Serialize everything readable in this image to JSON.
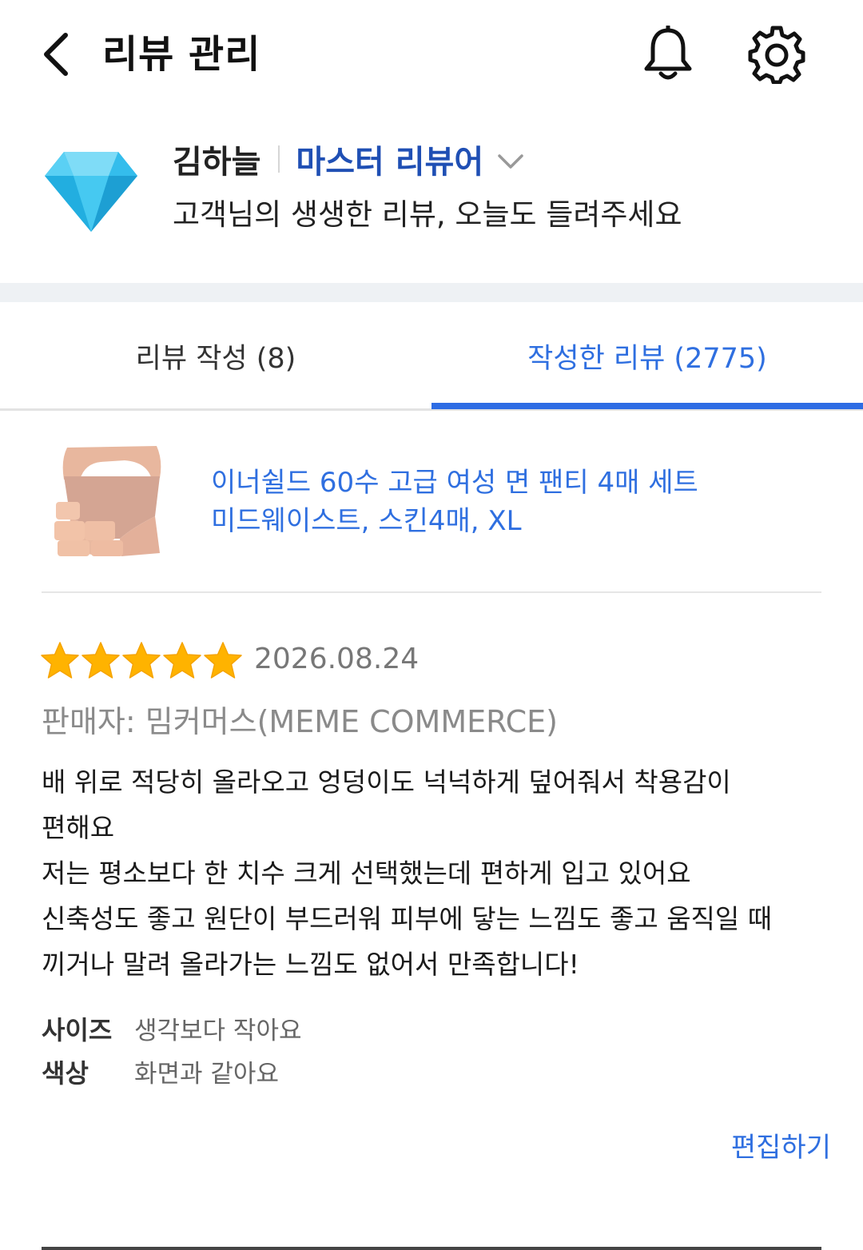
{
  "header": {
    "title": "리뷰 관리",
    "back_icon": "chevron-left-icon",
    "bell_icon": "bell-icon",
    "settings_icon": "gear-icon"
  },
  "profile": {
    "name": "김하늘",
    "grade": "마스터 리뷰어",
    "tagline": "고객님의 생생한 리뷰, 오늘도 들려주세요",
    "badge_icon": "diamond-icon",
    "badge_color": "#3cc3ee"
  },
  "tabs": [
    {
      "label": "리뷰 작성 (8)",
      "active": false
    },
    {
      "label": "작성한 리뷰 (2775)",
      "active": true
    }
  ],
  "accent_color": "#2d6ce4",
  "review": {
    "product": {
      "name_line1": "이너쉴드 60수 고급 여성 면 팬티 4매 세트",
      "name_line2": "미드웨이스트, 스킨4매, XL"
    },
    "rating": 5,
    "rating_max": 5,
    "date": "2026.08.24",
    "seller": "판매자: 밈커머스(MEME COMMERCE)",
    "body_lines": [
      "배 위로 적당히 올라오고 엉덩이도 넉넉하게 덮어줘서 착용감이",
      "편해요",
      "저는 평소보다 한 치수 크게 선택했는데 편하게 입고 있어요",
      "신축성도 좋고 원단이 부드러워 피부에 닿는 느낌도 좋고 움직일 때",
      "끼거나 말려 올라가는 느낌도 없어서 만족합니다!"
    ],
    "attributes": [
      {
        "key": "사이즈",
        "value": "생각보다 작아요"
      },
      {
        "key": "색상",
        "value": "화면과 같아요"
      }
    ],
    "edit_label": "편집하기"
  }
}
